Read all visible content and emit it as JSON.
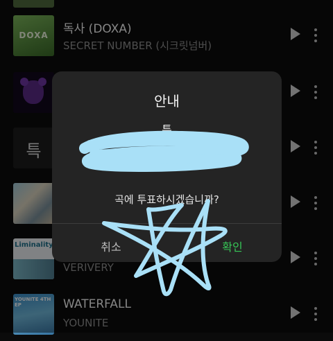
{
  "tracks": [
    {
      "cover_text": "DOXA",
      "title": "독사 (DOXA)",
      "artist": "SECRET NUMBER (시크릿넘버)"
    },
    {
      "cover_text": "",
      "title": "",
      "artist": ""
    },
    {
      "cover_text": "특",
      "title": "",
      "artist": ""
    },
    {
      "cover_text": "",
      "title": "",
      "artist": ""
    },
    {
      "cover_text": "Liminality",
      "title": "",
      "artist": "VERIVERY"
    },
    {
      "cover_text": "YOUNITE 4TH EP",
      "title": "WATERFALL",
      "artist": "YOUNITE"
    }
  ],
  "dialog": {
    "title": "안내",
    "track_name": "특",
    "message": "곡에 투표하시겠습니까?",
    "cancel_label": "취소",
    "confirm_label": "확인"
  },
  "colors": {
    "background": "#0b0b0b",
    "dialog": "#242424",
    "confirm": "#37c857",
    "scribble": "#a9e0f7"
  },
  "icons": [
    "play-icon",
    "more-vertical-icon",
    "scribble-star-overlay"
  ]
}
